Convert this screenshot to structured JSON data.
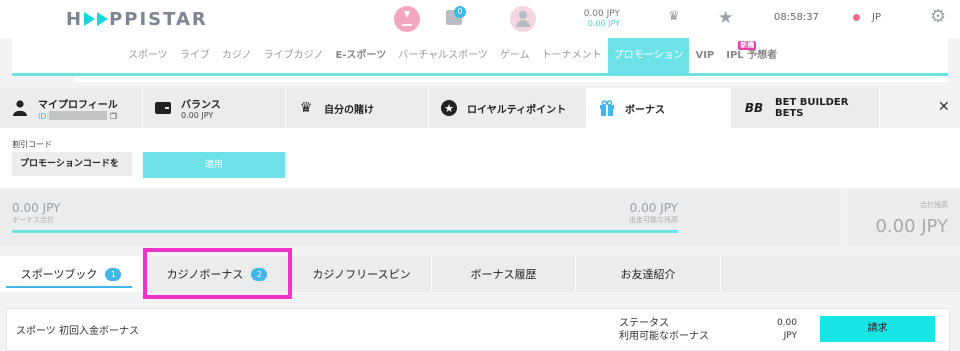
{
  "brand": {
    "logo_left": "H",
    "logo_right": "PPISTAR",
    "accent": "#6de2e6",
    "highlight": "#f032c8"
  },
  "topbar": {
    "gift_badge": "0",
    "balance": "0.00 JPY",
    "balance_sub": "0.00 JPY",
    "time": "08:58:37",
    "language": "JP"
  },
  "nav": {
    "items": [
      "スポーツ",
      "ライブ",
      "カジノ",
      "ライブカジノ",
      "E-スポーツ",
      "バーチャルスポーツ",
      "ゲーム",
      "トーナメント",
      "プロモーション",
      "VIP",
      "IPL 予想者"
    ],
    "active": "プロモーション",
    "ipl_badge": "新機"
  },
  "tabs": {
    "profile_title": "マイプロフィール",
    "profile_id_label": "ID:",
    "balance_title": "バランス",
    "balance_value": "0.00 JPY",
    "bets": "自分の賭け",
    "loyalty": "ロイヤルティポイント",
    "bonus": "ボーナス",
    "bet_builder": "BET BUILDER BETS"
  },
  "promo": {
    "label": "割引コード",
    "input_value": "プロモーションコードを",
    "apply": "適用"
  },
  "bonus_summary": {
    "bonus_amount": "0.00 JPY",
    "bonus_label": "ボーナス合計",
    "withdrawable_amount": "0.00 JPY",
    "withdrawable_label": "出金可能な残高",
    "total_label": "合計残高",
    "total_value": "0.00 JPY"
  },
  "subtabs": [
    {
      "label": "スポーツブック",
      "count": "1"
    },
    {
      "label": "カジノボーナス",
      "count": "2"
    },
    {
      "label": "カジノフリースピン"
    },
    {
      "label": "ボーナス履歴"
    },
    {
      "label": "お友達紹介"
    }
  ],
  "bonus_row": {
    "name": "スポーツ 初回入金ボーナス",
    "status_label": "ステータス",
    "available_label": "利用可能なボーナス",
    "amount": "0.00",
    "currency": "JPY",
    "claim": "請求"
  }
}
